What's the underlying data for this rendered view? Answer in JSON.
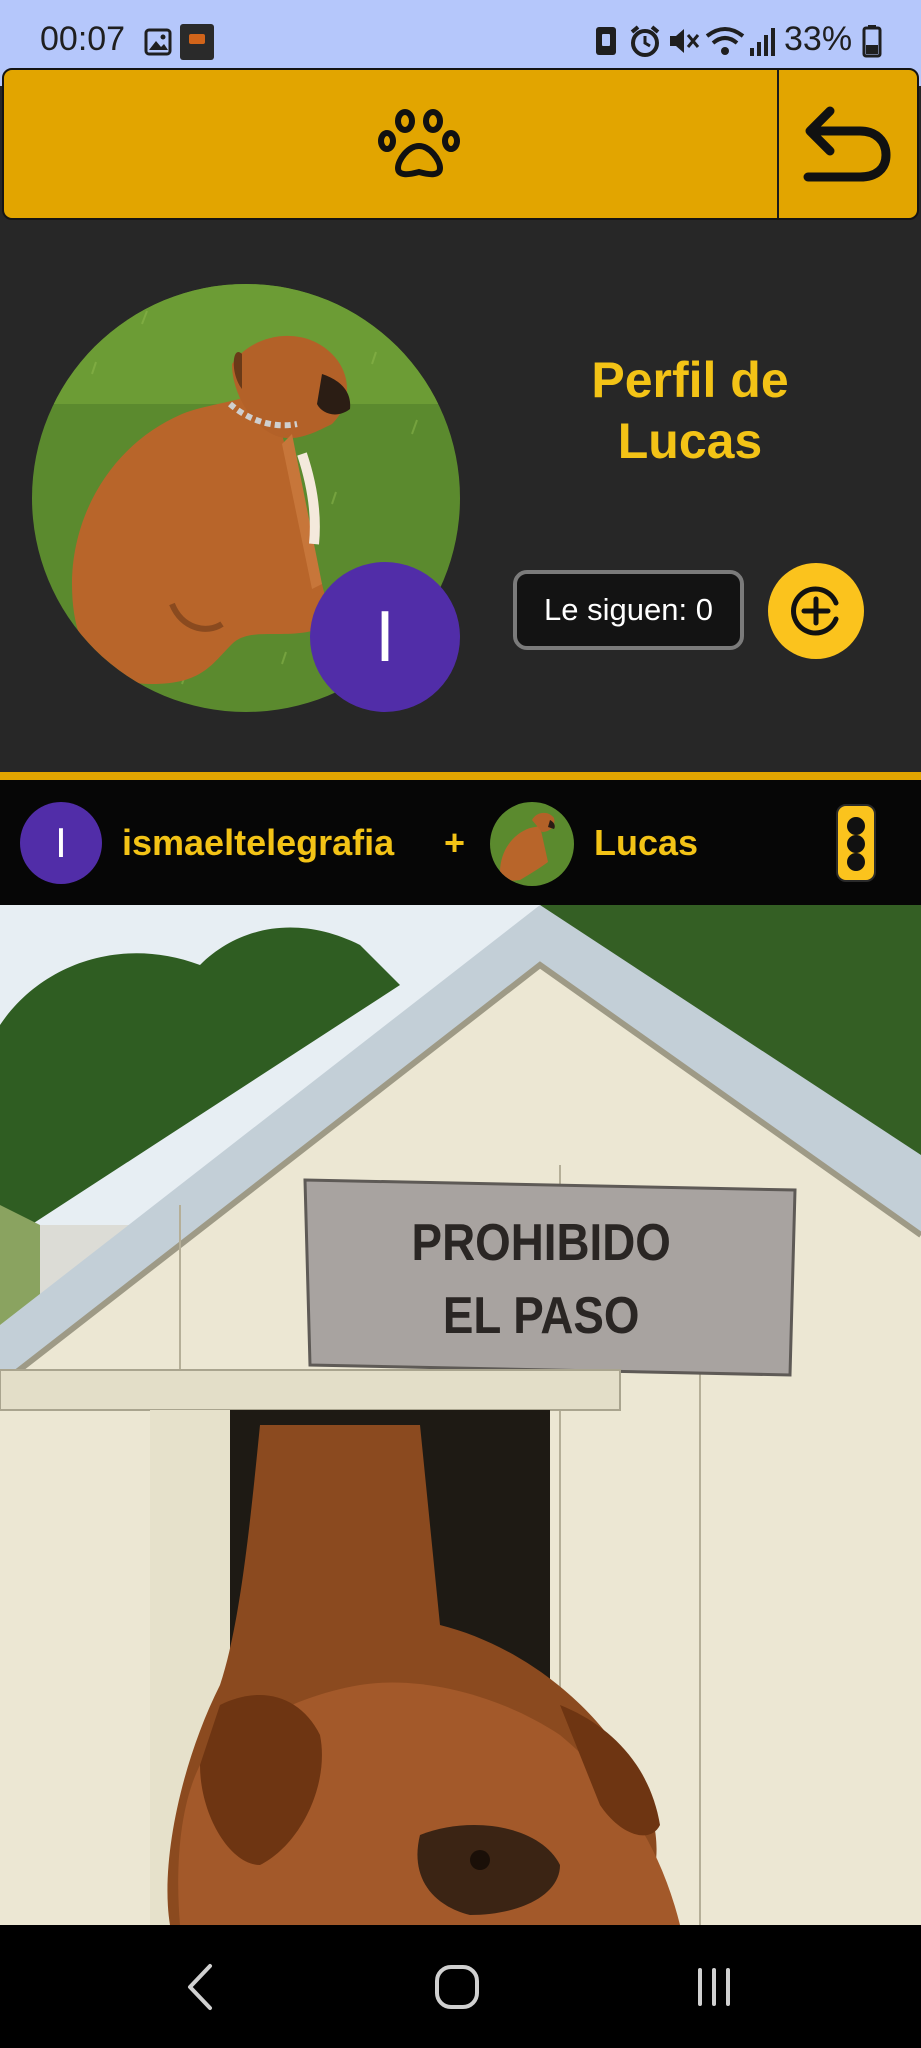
{
  "status_bar": {
    "time": "00:07",
    "battery_percent": "33%",
    "icons": [
      "image-icon",
      "app-notification-icon",
      "nfc-icon",
      "alarm-icon",
      "mute-icon",
      "wifi-icon",
      "signal-icon",
      "battery-icon"
    ]
  },
  "top_bar": {
    "center_icon": "paw-icon",
    "back_icon": "back-arrow-icon",
    "color": "#e2a500"
  },
  "profile": {
    "title": "Perfil de Lucas",
    "owner_initial": "I",
    "followers_label": "Le siguen: 0",
    "follow_icon": "plus-circle-icon",
    "accent": "#f3c316",
    "badge_color": "#512da8"
  },
  "post": {
    "owner_initial": "I",
    "owner_name": "ismaeltelegrafia",
    "joiner": "+",
    "pet_name": "Lucas",
    "menu_icon": "more-vertical-icon",
    "sign_line1": "PROHIBIDO",
    "sign_line2": "EL PASO"
  },
  "nav_bar": {
    "icons": [
      "back-nav-icon",
      "home-nav-icon",
      "recents-nav-icon"
    ]
  }
}
